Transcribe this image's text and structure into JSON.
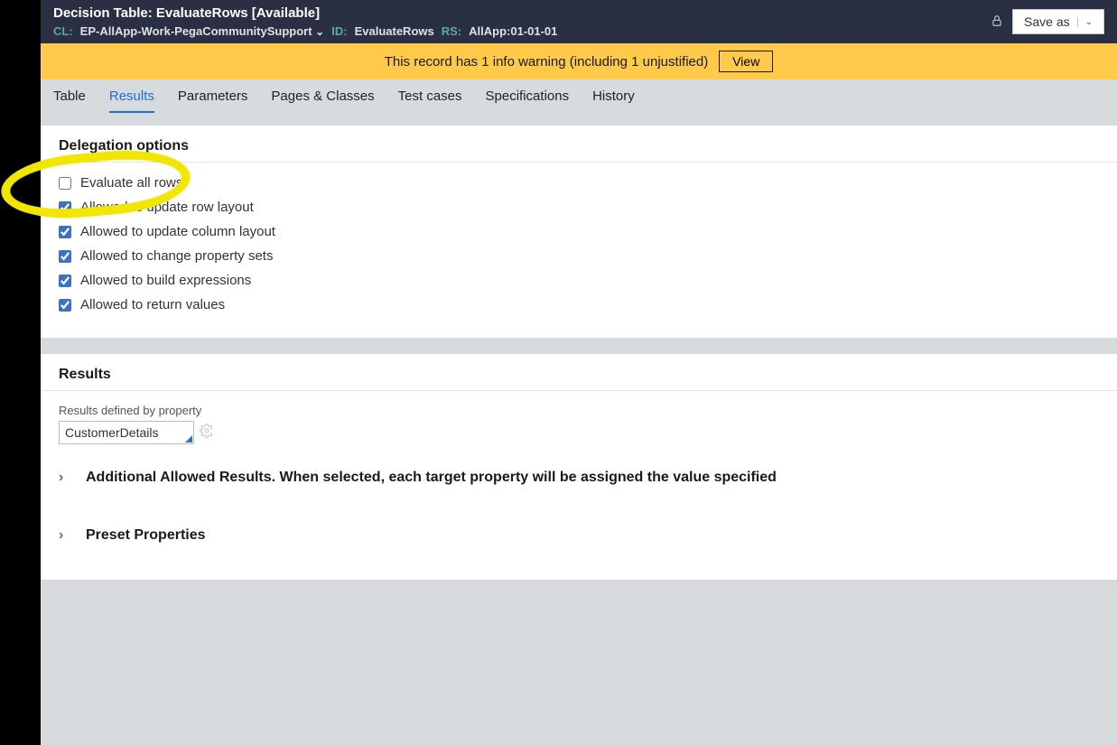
{
  "header": {
    "title": "Decision Table: EvaluateRows [Available]",
    "cl_label": "CL:",
    "cl_value": "EP-AllApp-Work-PegaCommunitySupport",
    "id_label": "ID:",
    "id_value": "EvaluateRows",
    "rs_label": "RS:",
    "rs_value": "AllApp:01-01-01",
    "saveas_label": "Save as"
  },
  "warning": {
    "text": "This record has 1 info warning (including 1 unjustified)",
    "view_label": "View"
  },
  "tabs": {
    "items": [
      {
        "label": "Table"
      },
      {
        "label": "Results"
      },
      {
        "label": "Parameters"
      },
      {
        "label": "Pages & Classes"
      },
      {
        "label": "Test cases"
      },
      {
        "label": "Specifications"
      },
      {
        "label": "History"
      }
    ],
    "active_index": 1
  },
  "delegation": {
    "title": "Delegation options",
    "options": [
      {
        "label": "Evaluate all rows",
        "checked": false
      },
      {
        "label": "Allowed to update row layout",
        "checked": true
      },
      {
        "label": "Allowed to update column layout",
        "checked": true
      },
      {
        "label": "Allowed to change property sets",
        "checked": true
      },
      {
        "label": "Allowed to build expressions",
        "checked": true
      },
      {
        "label": "Allowed to return values",
        "checked": true
      }
    ]
  },
  "results": {
    "title": "Results",
    "field_label": "Results defined by property",
    "field_value": "CustomerDetails",
    "expanders": [
      {
        "label": "Additional Allowed Results. When selected, each target property will be assigned the value specified"
      },
      {
        "label": "Preset Properties"
      }
    ]
  }
}
